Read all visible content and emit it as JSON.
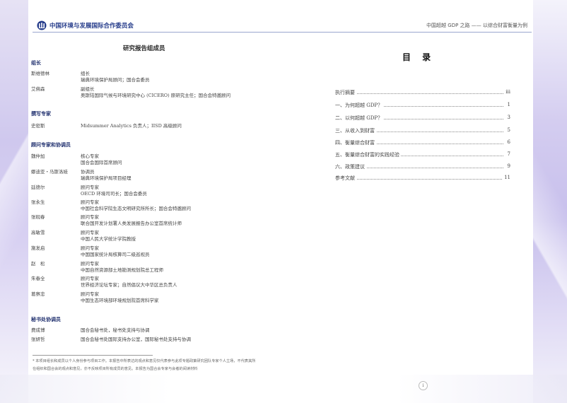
{
  "header": {
    "org_name": "中国环境与发展国际合作委员会",
    "report_title": "中国超越 GDP 之路 —— 以综合财富衡量为例"
  },
  "left": {
    "title": "研究报告组成员",
    "sections": [
      {
        "heading": "组长",
        "members": [
          {
            "name": "斯维德林",
            "role": "组长",
            "desc": "瑞典环境保护局顾问；国合会委员"
          },
          {
            "name": "艾佛森",
            "role": "副组长",
            "desc": "奥斯陆国际气候与环境研究中心 (CICERO) 原研究主任；国合会特邀顾问"
          }
        ]
      },
      {
        "heading": "撰写专家",
        "members": [
          {
            "name": "史密斯",
            "role": "Midsummer Analytics 负责人；IISD 高级顾问",
            "desc": ""
          }
        ]
      },
      {
        "heading": "顾问专家和协调员",
        "members": [
          {
            "name": "魏仲加",
            "role": "核心专家",
            "desc": "国合会国际首席顾问"
          },
          {
            "name": "娜迪亚・马斯洛娃",
            "role": "协调员",
            "desc": "瑞典环境保护局项目经理"
          },
          {
            "name": "廷德尔",
            "role": "顾问专家",
            "desc": "OECD 环境司司长；国合会委员"
          },
          {
            "name": "张永生",
            "role": "顾问专家",
            "desc": "中国社会科学院生态文明研究所所长；国合会特邀顾问"
          },
          {
            "name": "张砚春",
            "role": "顾问专家",
            "desc": "联合国开发计划署人类发展报告办公室首席统计师"
          },
          {
            "name": "高敏雪",
            "role": "顾问专家",
            "desc": "中国人民大学统计学院教授"
          },
          {
            "name": "施发启",
            "role": "顾问专家",
            "desc": "中国国家统计局核算司二级巡视员"
          },
          {
            "name": "赵　松",
            "role": "顾问专家",
            "desc": "中国自然资源部土地勘测规划院总工程师"
          },
          {
            "name": "朱春全",
            "role": "顾问专家",
            "desc": "世界经济论坛专家；自然倡议大中华区总负责人"
          },
          {
            "name": "葛察忠",
            "role": "顾问专家",
            "desc": "中国生态环境部环境规划院首席科学家"
          }
        ]
      },
      {
        "heading": "秘书处协调员",
        "members": [
          {
            "name": "费成博",
            "role": "国合会秘书处，秘书处支持与协调",
            "desc": ""
          },
          {
            "name": "张妍哲",
            "role": "国合会秘书处国际支持办公室，国际秘书处支持与协调",
            "desc": ""
          }
        ]
      }
    ],
    "footnote": "* 本项目组长和成员以个人身份参与项目工作。本报告中所表达的观点和意见仅代表参与此项专题政策研究团队专家个人立场，不代表其所在组织和国合会的观点和意见，亦不反映项目所有成员的意见。本报告为国合会专家与会者的阅读材料"
  },
  "toc": {
    "title": "目 录",
    "items": [
      {
        "label": "执行摘要",
        "page": "iii"
      },
      {
        "label": "一、为何超越 GDP？",
        "page": "1"
      },
      {
        "label": "二、以何超越 GDP？",
        "page": "3"
      },
      {
        "label": "三、从收入到财富",
        "page": "5"
      },
      {
        "label": "四、衡量综合财富",
        "page": "6"
      },
      {
        "label": "五、衡量综合财富的实践经验",
        "page": "7"
      },
      {
        "label": "六、政策建议",
        "page": "9"
      },
      {
        "label": "参考文献",
        "page": "11"
      }
    ]
  },
  "page_number": "i"
}
